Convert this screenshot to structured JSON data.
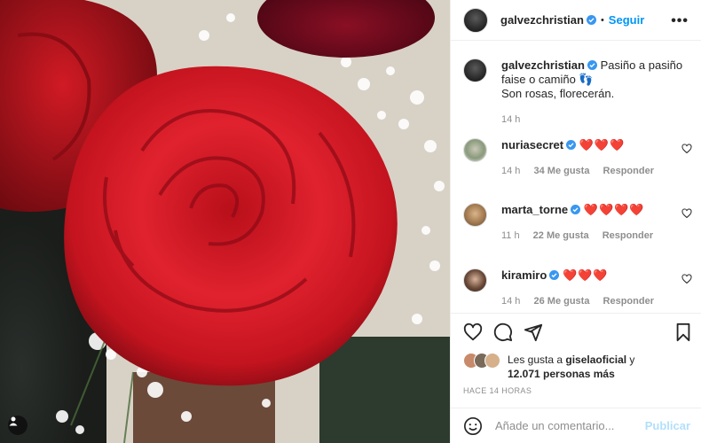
{
  "post": {
    "author": "galvezchristian",
    "dot": "•",
    "follow_label": "Seguir",
    "more_label": "•••",
    "caption_line1": "Pasiño a pasiño",
    "caption_line2": "faise o camiño 👣",
    "caption_line3": "Son rosas, florecerán.",
    "caption_time": "14 h"
  },
  "comments": [
    {
      "user": "nuriasecret",
      "verified": true,
      "text": "❤️❤️❤️",
      "time": "14 h",
      "likes": "34 Me gusta",
      "reply": "Responder"
    },
    {
      "user": "marta_torne",
      "verified": true,
      "text": "❤️❤️❤️❤️",
      "time": "11 h",
      "likes": "22 Me gusta",
      "reply": "Responder"
    },
    {
      "user": "kiramiro",
      "verified": true,
      "text": "❤️❤️❤️",
      "time": "14 h",
      "likes": "26 Me gusta",
      "reply": "Responder"
    }
  ],
  "likes": {
    "prefix": "Les gusta a ",
    "user": "giselaoficial",
    "suffix": " y",
    "line2": "12.071 personas más"
  },
  "time_ago": "HACE 14 HORAS",
  "composer": {
    "placeholder": "Añade un comentario...",
    "publish_label": "Publicar"
  },
  "icons": [
    "heart-icon",
    "comment-icon",
    "share-icon",
    "bookmark-icon",
    "emoji-icon",
    "more-icon",
    "verified-icon",
    "tagged-user-icon"
  ],
  "colors": {
    "accent": "#0095f6",
    "verified": "#3897f0",
    "publish_disabled": "#b2dffc",
    "muted": "#8e8e8e"
  }
}
